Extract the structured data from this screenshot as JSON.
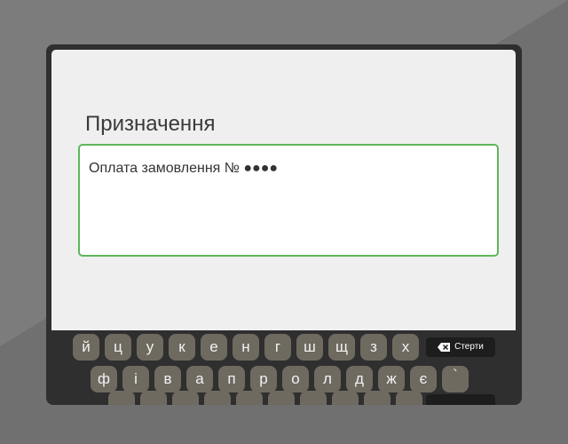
{
  "form": {
    "label": "Призначення",
    "value": "Оплата замовлення № ●●●●"
  },
  "keyboard": {
    "row1": [
      "й",
      "ц",
      "у",
      "к",
      "е",
      "н",
      "г",
      "ш",
      "щ",
      "з",
      "х"
    ],
    "row2": [
      "ф",
      "і",
      "в",
      "а",
      "п",
      "р",
      "о",
      "л",
      "д",
      "ж",
      "є",
      "`"
    ],
    "erase_label": "Стерти",
    "erase_icon": "backspace-icon"
  },
  "colors": {
    "background": "#7c7c7c",
    "device": "#2f2f2f",
    "screen": "#efefef",
    "field_border": "#5fb65a",
    "key": "#6f6a60",
    "erase_key": "#1d1d1d"
  }
}
